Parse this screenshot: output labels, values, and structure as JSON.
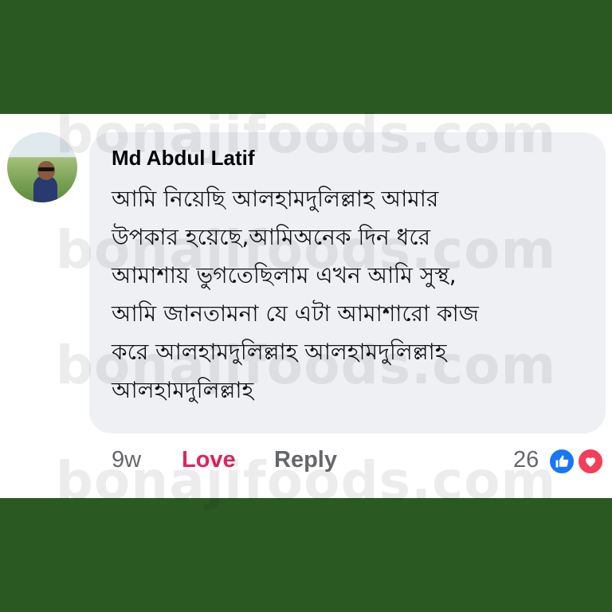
{
  "watermark": "bonajifoods.com",
  "comment": {
    "author": "Md Abdul Latif",
    "lines": [
      "আমি নিয়েছি আলহামদুলিল্লাহ  আমার",
      "উপকার হয়েছে,আমিঅনেক দিন ধরে",
      "আমাশায় ভুগতেছিলাম এখন আমি সুস্থ,",
      "আমি জানতামনা যে এটা আমাশারো কাজ",
      "করে আলহামদুলিল্লাহ  আলহামদুলিল্লাহ",
      "আলহামদুলিল্লাহ"
    ],
    "time": "9w",
    "love_label": "Love",
    "reply_label": "Reply",
    "reaction_count": "26",
    "reactions": [
      "like-icon",
      "heart-icon"
    ]
  },
  "colors": {
    "frame_green": "#2a5a22",
    "bubble": "#eef0f4",
    "love_red": "#e0245e",
    "like_blue": "#1877f2",
    "heart_red": "#f33e58"
  }
}
